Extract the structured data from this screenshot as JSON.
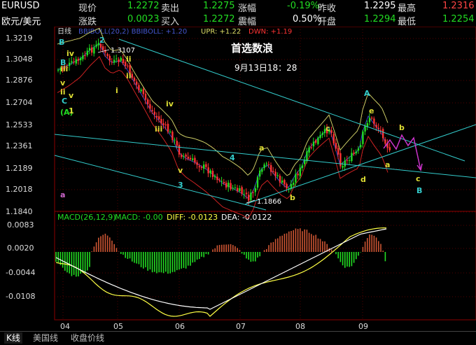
{
  "header": {
    "row1": {
      "symbol": "EURUSD",
      "last_label": "现价",
      "last_value": "1.2272",
      "bid_label": "卖出",
      "bid_value": "1.2275",
      "change_pct_label": "涨幅",
      "change_pct_value": "-0.19%",
      "prev_label": "昨收",
      "prev_value": "1.2295",
      "high_label": "最高",
      "high_value": "1.2316"
    },
    "row2": {
      "name": "欧元/美元",
      "change_label": "涨跌",
      "change_value": "0.0023",
      "ask_label": "买入",
      "ask_value": "1.2272",
      "amp_label": "震幅",
      "amp_value": "0.50%",
      "open_label": "开盘",
      "open_value": "1.2294",
      "low_label": "最低",
      "low_value": "1.2254"
    }
  },
  "chart": {
    "period": "日线",
    "indicator": "BBIBOLL(20,2) BBIBOLL: +1.20",
    "upr": "UPR: +1.22",
    "dwn": "DWN: +1.19",
    "title": "首选数浪",
    "date_text": "9月13日18：28",
    "price_labels": [
      "1.3219",
      "1.3048",
      "1.2876",
      "1.2704",
      "1.2533",
      "1.2361",
      "1.2189",
      "1.2018",
      "1.1840"
    ],
    "high_annotation": "1.3107",
    "low_annotation": "1.1866",
    "macd_title": "MACD(26,12,9)",
    "macd_value": "MACD: -0.00",
    "diff_value": "DIFF: -0.0123",
    "dea_value": "DEA: -0.0122",
    "macd_labels": [
      "0.0083",
      "0.0020",
      "-0.0044",
      "-0.0108"
    ],
    "month_labels": [
      "04",
      "05",
      "06",
      "07",
      "08",
      "09"
    ],
    "wave_labels": {
      "B_top": "B",
      "two": "2",
      "iv_top": "iv",
      "ii_top": "ii",
      "B_left": "B",
      "iii_left": "iii",
      "ii_left": "ii",
      "v_left": "v",
      "i_left": "i",
      "C_left": "C",
      "A_paren": "(A)",
      "one": "1",
      "v_small": "v",
      "i_mid": "i",
      "ii_mid": "ii",
      "iv_mid": "iv",
      "iii_mid": "iii",
      "v_low": "v",
      "three": "3",
      "four": "4",
      "a1": "a",
      "b1": "b",
      "c1": "c",
      "d1": "d",
      "e1": "e",
      "A_right": "A",
      "a2": "a",
      "b2": "b",
      "c2": "c",
      "B_right": "B",
      "a_pink": "a"
    },
    "colors": {
      "up": "#22dd22",
      "down": "#ff3333",
      "upper_band": "#cccc66",
      "lower_band": "#cc2222",
      "mid_band": "#3344cc",
      "trend": "#33cccc",
      "diff": "#ffff44",
      "dea": "#ffffff",
      "forecast": "#cc33cc"
    }
  },
  "bottom_tabs": [
    "K线",
    "美国线",
    "收盘价线"
  ]
}
